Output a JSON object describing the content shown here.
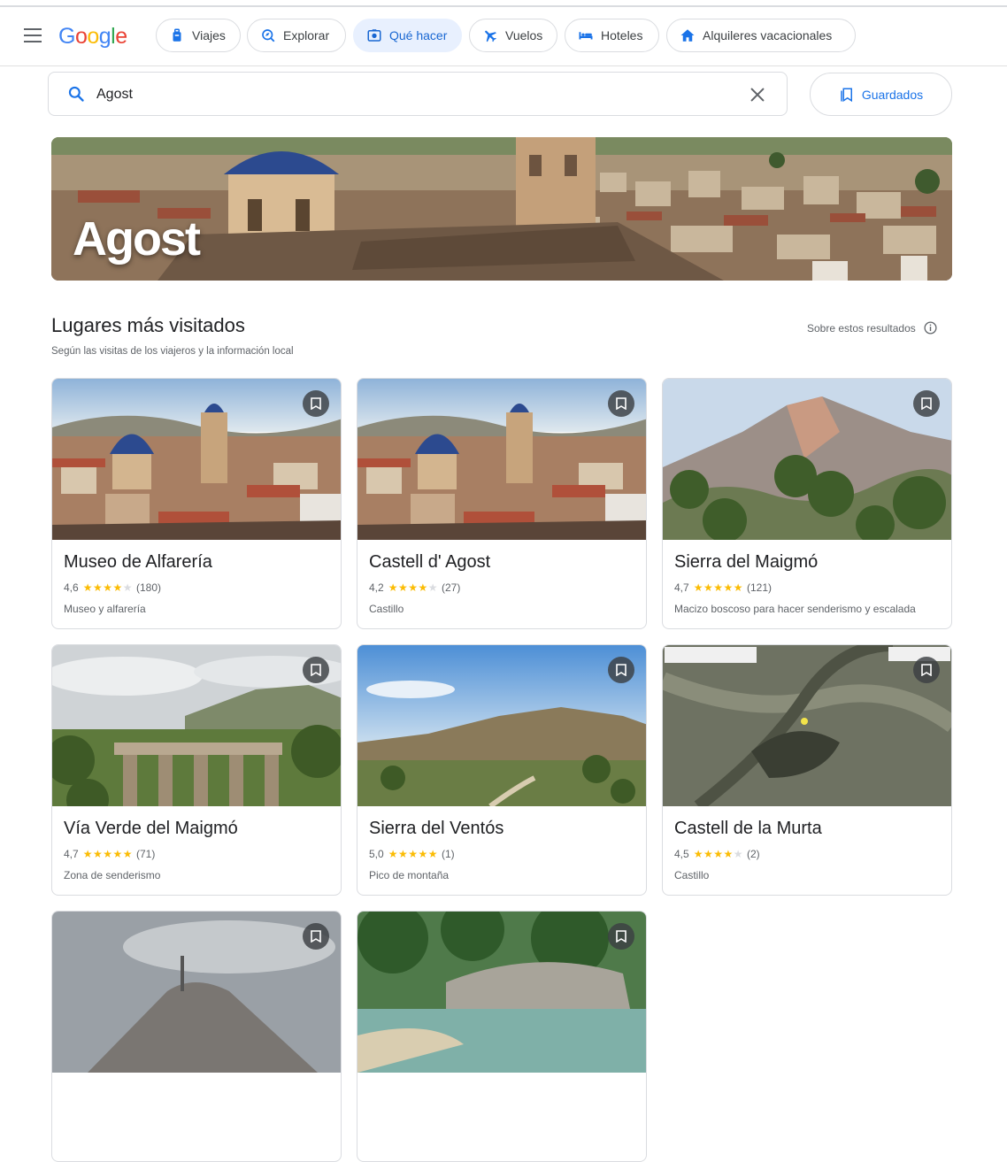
{
  "header": {
    "logo": "Google",
    "tabs": [
      {
        "label": "Viajes",
        "icon": "suitcase-icon",
        "active": false
      },
      {
        "label": "Explorar",
        "icon": "explore-icon",
        "active": false
      },
      {
        "label": "Qué hacer",
        "icon": "camera-icon",
        "active": true
      },
      {
        "label": "Vuelos",
        "icon": "plane-icon",
        "active": false
      },
      {
        "label": "Hoteles",
        "icon": "bed-icon",
        "active": false
      },
      {
        "label": "Alquileres vacacionales",
        "icon": "house-icon",
        "active": false
      }
    ]
  },
  "search": {
    "value": "Agost"
  },
  "saved": {
    "label": "Guardados"
  },
  "hero": {
    "title": "Agost"
  },
  "section": {
    "title": "Lugares más visitados",
    "subtitle": "Según las visitas de los viajeros y la información local",
    "about": "Sobre estos resultados"
  },
  "places": [
    {
      "name": "Museo de Alfarería",
      "rating": "4,6",
      "stars": 4.5,
      "reviews": "(180)",
      "category": "Museo y alfarería"
    },
    {
      "name": "Castell d' Agost",
      "rating": "4,2",
      "stars": 4,
      "reviews": "(27)",
      "category": "Castillo"
    },
    {
      "name": "Sierra del Maigmó",
      "rating": "4,7",
      "stars": 5,
      "reviews": "(121)",
      "category": "Macizo boscoso para hacer senderismo y escalada"
    },
    {
      "name": "Vía Verde del Maigmó",
      "rating": "4,7",
      "stars": 5,
      "reviews": "(71)",
      "category": "Zona de senderismo"
    },
    {
      "name": "Sierra del Ventós",
      "rating": "5,0",
      "stars": 5,
      "reviews": "(1)",
      "category": "Pico de montaña"
    },
    {
      "name": "Castell de la Murta",
      "rating": "4,5",
      "stars": 4.5,
      "reviews": "(2)",
      "category": "Castillo"
    },
    {
      "name": "",
      "rating": "",
      "stars": 0,
      "reviews": "",
      "category": ""
    },
    {
      "name": "",
      "rating": "",
      "stars": 0,
      "reviews": "",
      "category": ""
    }
  ],
  "colors": {
    "accent": "#1a73e8",
    "active_chip_bg": "#e8f0fe",
    "star": "#fbbc04"
  }
}
